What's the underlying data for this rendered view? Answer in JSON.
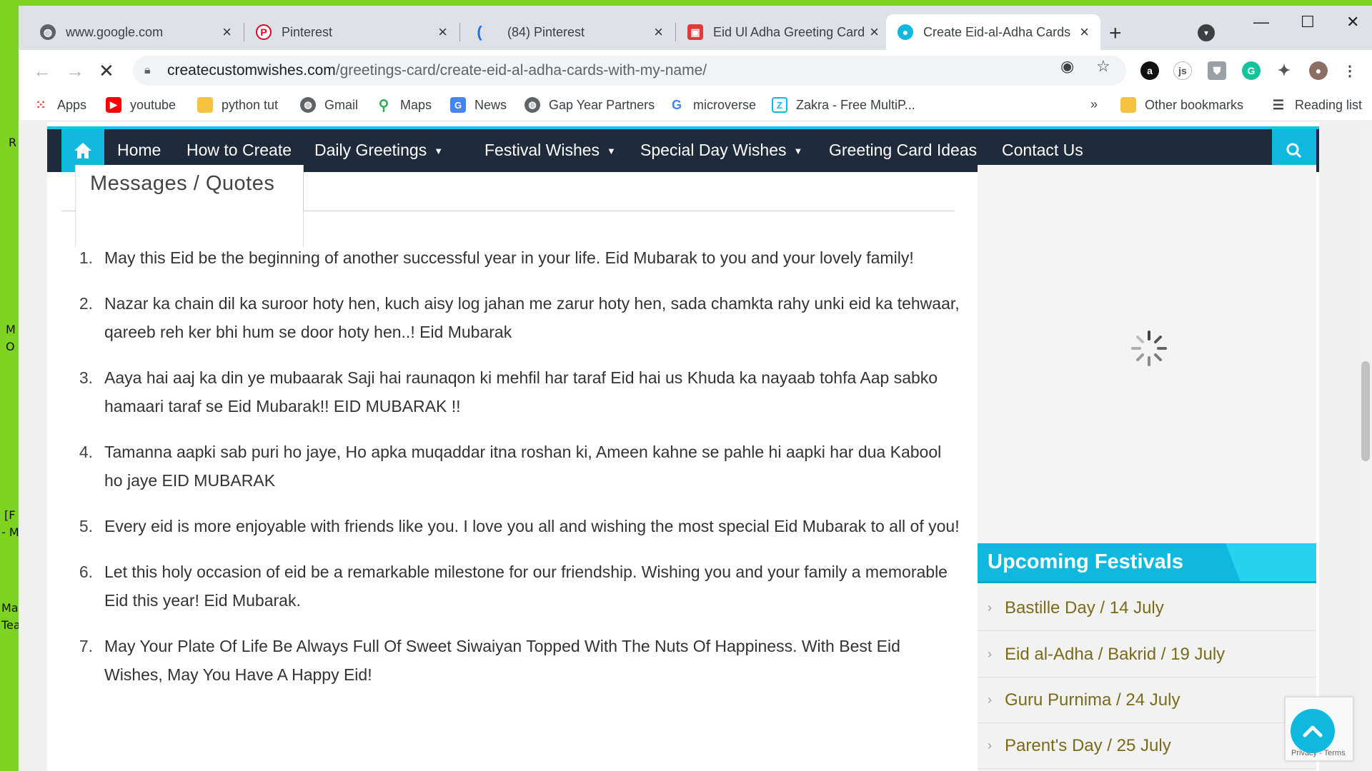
{
  "tabs": [
    {
      "title": "www.google.com",
      "favicon": "globe-icon",
      "color": "#5f6368"
    },
    {
      "title": "Pinterest",
      "favicon": "pinterest-icon",
      "color": "#e60023"
    },
    {
      "title": "(84) Pinterest",
      "favicon": "loading-icon",
      "color": "#1a73e8"
    },
    {
      "title": "Eid Ul Adha Greeting Card",
      "favicon": "card-icon",
      "color": "#e53935"
    },
    {
      "title": "Create Eid-al-Adha Cards",
      "favicon": "site-icon",
      "color": "#0fb8de"
    }
  ],
  "url": {
    "host": "createcustomwishes.com",
    "path": "/greetings-card/create-eid-al-adha-cards-with-my-name/"
  },
  "bookmarks": {
    "items": [
      {
        "label": "Apps",
        "icon": "apps-grid-icon"
      },
      {
        "label": "youtube",
        "icon": "youtube-icon"
      },
      {
        "label": "python tut",
        "icon": "folder-icon"
      },
      {
        "label": "Gmail",
        "icon": "globe-icon"
      },
      {
        "label": "Maps",
        "icon": "maps-pin-icon"
      },
      {
        "label": "News",
        "icon": "news-icon"
      },
      {
        "label": "Gap Year Partners",
        "icon": "globe-icon"
      },
      {
        "label": "microverse",
        "icon": "google-icon"
      },
      {
        "label": "Zakra - Free MultiP...",
        "icon": "zakra-icon"
      }
    ],
    "overflow": "»",
    "other": "Other bookmarks",
    "reading_list": "Reading list"
  },
  "nav": {
    "items": [
      {
        "label": "Home",
        "dropdown": false
      },
      {
        "label": "How to Create",
        "dropdown": false
      },
      {
        "label": "Daily Greetings",
        "dropdown": true
      },
      {
        "label": "Festival Wishes",
        "dropdown": true
      },
      {
        "label": "Special Day Wishes",
        "dropdown": true
      },
      {
        "label": "Greeting Card Ideas",
        "dropdown": false
      },
      {
        "label": "Contact Us",
        "dropdown": false
      }
    ]
  },
  "tab_label": "Messages / Quotes",
  "messages": [
    {
      "num": "1.",
      "text": "May this Eid be the beginning of another successful year in your life. Eid Mubarak to you and your lovely family!"
    },
    {
      "num": "2.",
      "text": "Nazar ka chain dil ka suroor hoty hen, kuch aisy log jahan me zarur hoty hen, sada chamkta rahy unki eid ka tehwaar, qareeb reh ker bhi hum se door hoty hen..! Eid Mubarak"
    },
    {
      "num": "3.",
      "text": "Aaya hai aaj ka din ye mubaarak Saji hai raunaqon ki mehfil har taraf Eid hai us Khuda ka nayaab tohfa Aap sabko hamaari taraf se Eid Mubarak!! EID MUBARAK !!"
    },
    {
      "num": "4.",
      "text": "Tamanna aapki sab puri ho jaye, Ho apka muqaddar itna roshan ki, Ameen kahne se pahle hi aapki har dua Kabool ho jaye EID MUBARAK"
    },
    {
      "num": "5.",
      "text": "Every eid is more enjoyable with friends like you. I love you all and wishing the most special Eid Mubarak to all of you!"
    },
    {
      "num": "6.",
      "text": "Let this holy occasion of eid be a remarkable milestone for our friendship. Wishing you and your family a memorable Eid this year! Eid Mubarak."
    },
    {
      "num": "7.",
      "text": "May Your Plate Of Life Be Always Full Of Sweet Siwaiyan Topped With The Nuts Of Happiness. With Best Eid Wishes, May You Have A Happy Eid!"
    }
  ],
  "festivals": {
    "title": "Upcoming Festivals",
    "items": [
      "Bastille Day / 14 July",
      "Eid al-Adha / Bakrid / 19 July",
      "Guru Purnima / 24 July",
      "Parent's Day / 25 July"
    ]
  },
  "recaptcha": {
    "text": "Privacy - Terms"
  },
  "desktop_edge": [
    "R",
    "M",
    "O",
    "[F",
    "- M",
    "Ma",
    "Tea"
  ],
  "colors": {
    "accent": "#0fb8de",
    "navbar": "#1f2a3a",
    "festival_text": "#7a6a1a"
  }
}
